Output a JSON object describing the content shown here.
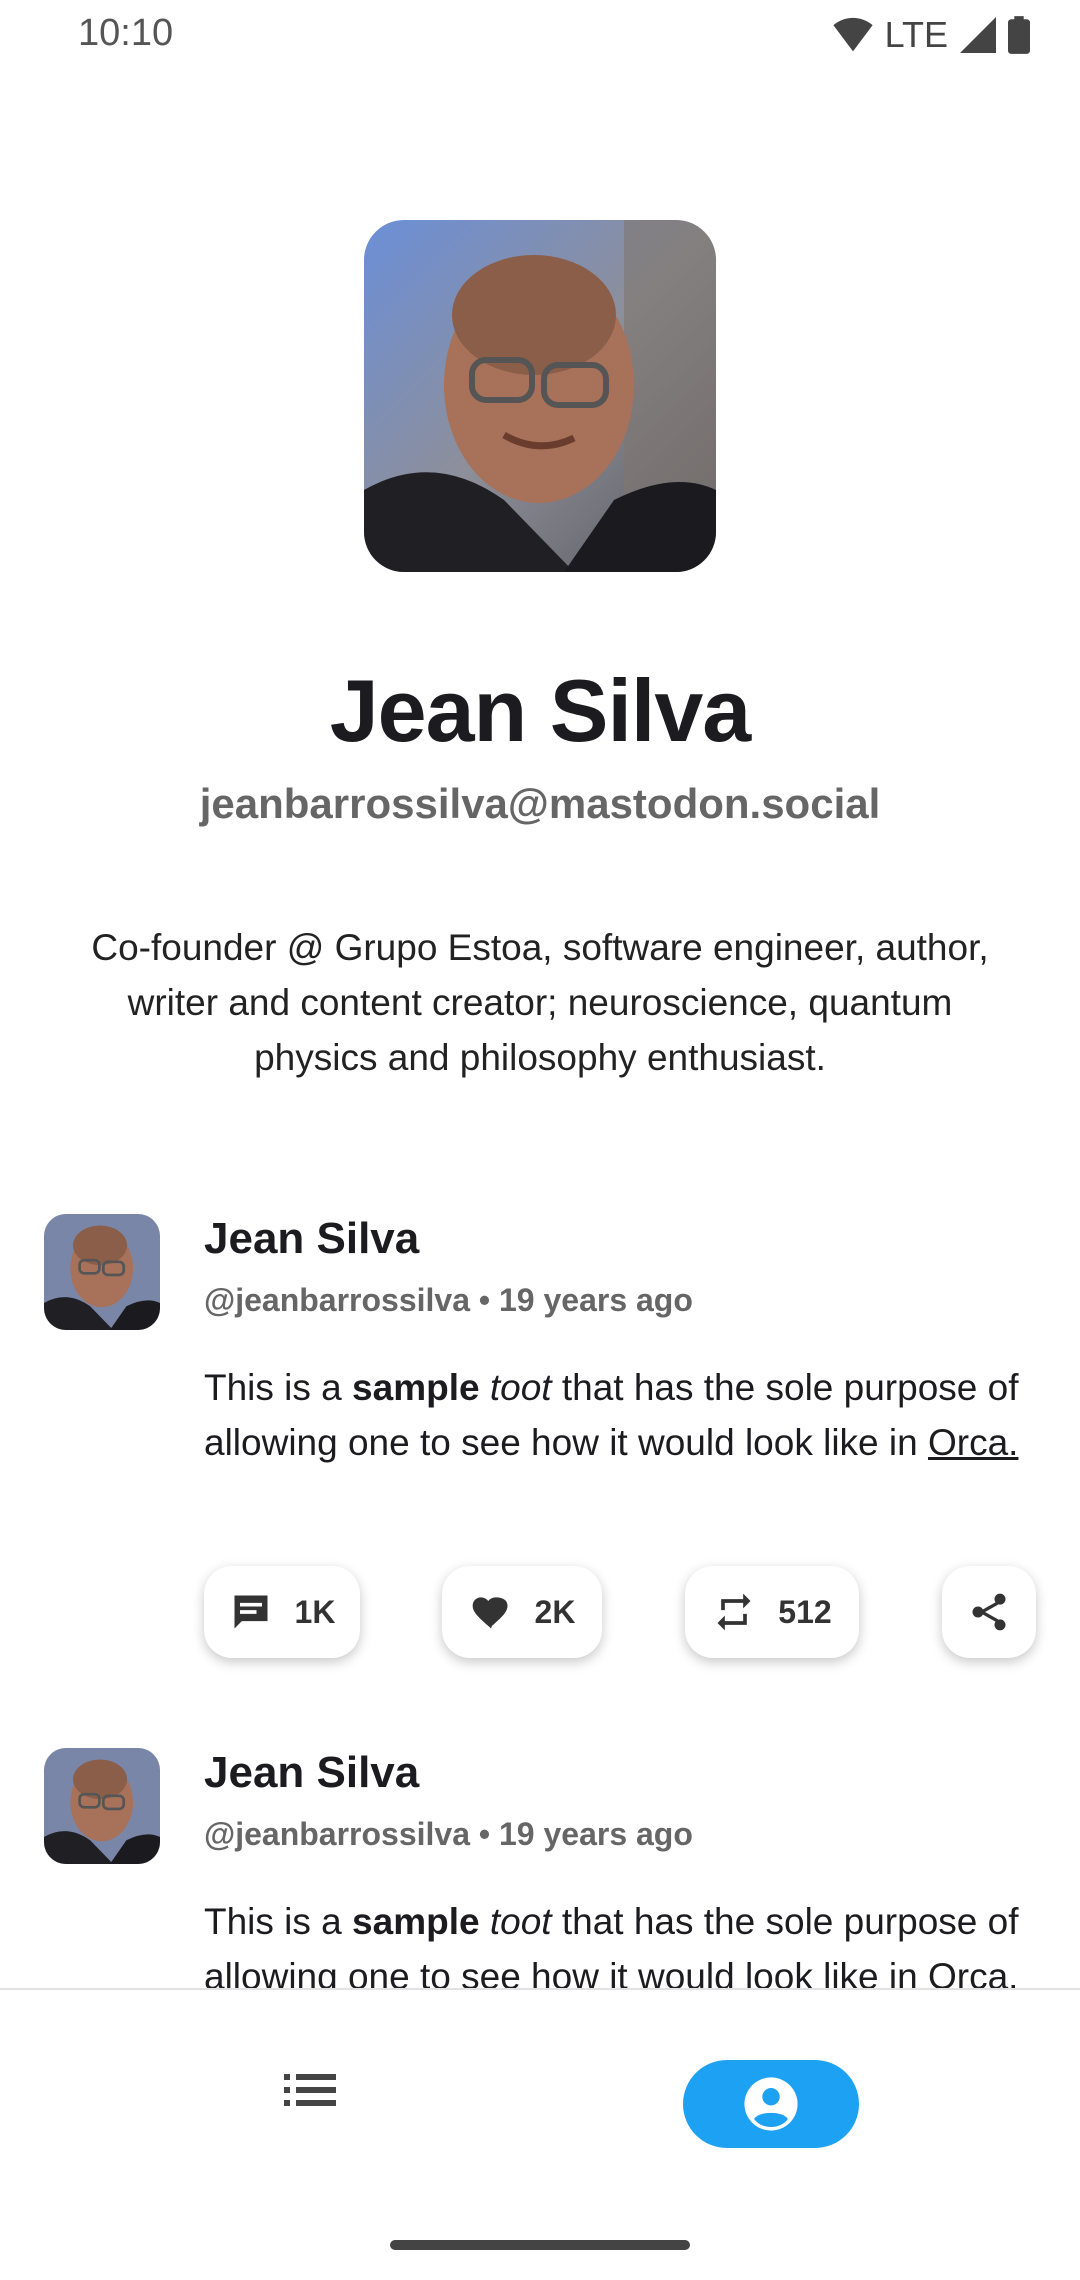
{
  "status_bar": {
    "time": "10:10",
    "network": "LTE"
  },
  "profile": {
    "name": "Jean Silva",
    "handle": "jeanbarrossilva@mastodon.social",
    "bio": "Co-founder @ Grupo Estoa, software engineer, author, writer and content creator; neuroscience, quantum physics and philosophy enthusiast."
  },
  "posts": [
    {
      "author": "Jean Silva",
      "meta": "@jeanbarrossilva • 19 years ago",
      "body": {
        "t1": "This is a ",
        "bold": "sample",
        "t2": " ",
        "italic": "toot",
        "t3": " that has the sole purpose of allowing one to see how it would look like in ",
        "link": "Orca."
      },
      "actions": {
        "comments": "1K",
        "favorites": "2K",
        "reblogs": "512"
      }
    },
    {
      "author": "Jean Silva",
      "meta": "@jeanbarrossilva • 19 years ago",
      "body": {
        "t1": "This is a ",
        "bold": "sample",
        "t2": " ",
        "italic": "toot",
        "t3": " that has the sole purpose of allowing one to see how it would look like in ",
        "link": "Orca."
      }
    }
  ],
  "bottom_nav": {
    "items": [
      {
        "icon": "feed-list-icon",
        "selected": false
      },
      {
        "icon": "account-circle-icon",
        "selected": true
      }
    ]
  },
  "colors": {
    "accent": "#1da1f2"
  }
}
